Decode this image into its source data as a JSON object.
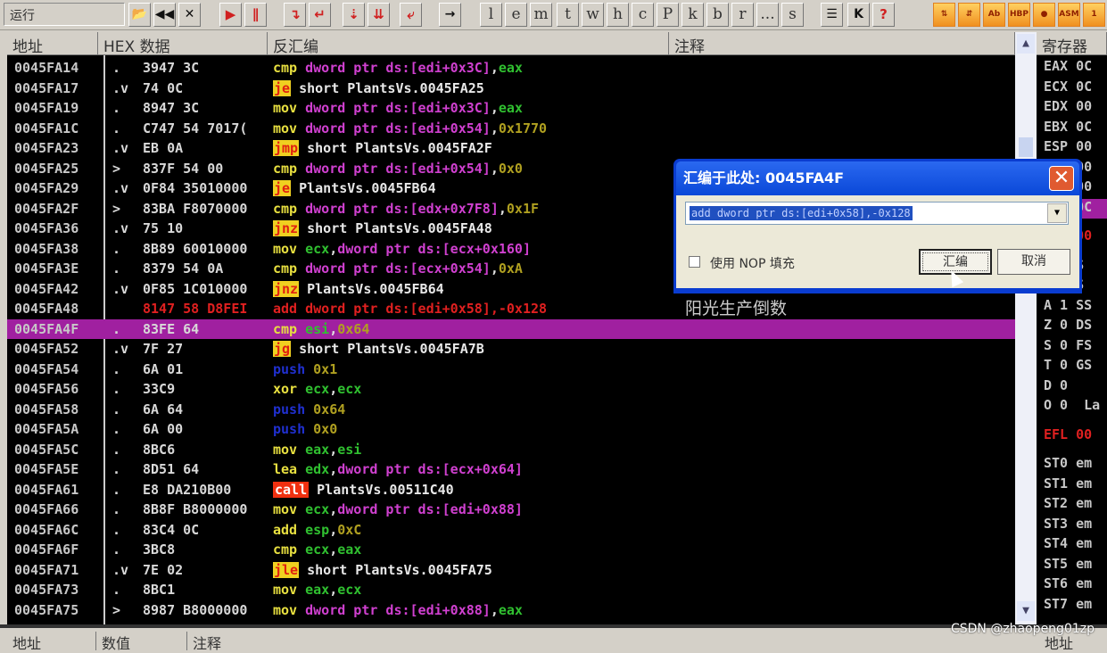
{
  "toolbar": {
    "status": "运行",
    "buttons": [
      {
        "icon": "open-folder-icon",
        "label": "📂",
        "cls": "dark"
      },
      {
        "icon": "restart-icon",
        "label": "◀◀",
        "cls": "dark"
      },
      {
        "icon": "close-icon",
        "label": "✕",
        "cls": "dark"
      },
      {
        "icon": "run-icon",
        "label": "▶",
        "cls": "red"
      },
      {
        "icon": "pause-icon",
        "label": "∥",
        "cls": "red"
      },
      {
        "icon": "step-into-icon",
        "label": "↴",
        "cls": "red"
      },
      {
        "icon": "step-over-icon",
        "label": "↵",
        "cls": "red"
      },
      {
        "icon": "trace-into-icon",
        "label": "⇣",
        "cls": "red"
      },
      {
        "icon": "trace-over-icon",
        "label": "⇊",
        "cls": "red"
      },
      {
        "icon": "execute-till-return-icon",
        "label": "⤶",
        "cls": "red"
      },
      {
        "icon": "go-to-icon",
        "label": "→",
        "cls": "dark"
      },
      {
        "icon": "log-window",
        "label": "l"
      },
      {
        "icon": "modules-window",
        "label": "e"
      },
      {
        "icon": "memory-window",
        "label": "m"
      },
      {
        "icon": "threads-window",
        "label": "t"
      },
      {
        "icon": "windows-window",
        "label": "w"
      },
      {
        "icon": "handles-window",
        "label": "h"
      },
      {
        "icon": "cpu-window",
        "label": "c"
      },
      {
        "icon": "patches-window",
        "label": "P"
      },
      {
        "icon": "call-stack-window",
        "label": "k"
      },
      {
        "icon": "breakpoints-window",
        "label": "b"
      },
      {
        "icon": "references-window",
        "label": "r"
      },
      {
        "icon": "run-trace-window",
        "label": "..."
      },
      {
        "icon": "source-window",
        "label": "s"
      },
      {
        "icon": "list-icon",
        "label": "☰",
        "cls": "dark"
      },
      {
        "icon": "plugin-icon",
        "label": "K",
        "cls": "dark"
      },
      {
        "icon": "help-icon",
        "label": "?",
        "cls": "red"
      },
      {
        "icon": "plugin-1-icon",
        "label": "⇅",
        "cls": "orange"
      },
      {
        "icon": "plugin-2-icon",
        "label": "⇵",
        "cls": "orange"
      },
      {
        "icon": "plugin-3-icon",
        "label": "Ab",
        "cls": "orange"
      },
      {
        "icon": "hbp-icon",
        "label": "HBP",
        "cls": "orange"
      },
      {
        "icon": "plugin-5-icon",
        "label": "●",
        "cls": "orange"
      },
      {
        "icon": "asm-icon",
        "label": "ASM",
        "cls": "orange"
      },
      {
        "icon": "plugin-7-icon",
        "label": "1",
        "cls": "orange"
      }
    ]
  },
  "headers": {
    "address": "地址",
    "hex": "HEX 数据",
    "disasm": "反汇编",
    "comment": "注释",
    "registers": "寄存器"
  },
  "bottom_headers": {
    "address": "地址",
    "value": "数值",
    "comment": "注释",
    "stack": "地址"
  },
  "colors": {
    "selection": "#a020a0",
    "background": "#000000",
    "jump_bg": "#f0d020",
    "call_bg": "#f03010",
    "memory": "#d040d0",
    "register": "#30c030",
    "immediate": "#b0a020",
    "push": "#2030d0",
    "modified": "#e02020"
  },
  "rows": [
    {
      "addr": "0045FA14",
      "mk": ".",
      "hex": "3947 3C",
      "dis": [
        [
          "cmp",
          "mn"
        ],
        [
          " "
        ],
        [
          "dword ptr ds:[edi+0x3C]",
          "mem"
        ],
        [
          ","
        ],
        [
          "eax",
          "reg"
        ]
      ]
    },
    {
      "addr": "0045FA17",
      "mk": ".v",
      "hex": "74 0C",
      "dis": [
        [
          "je",
          "jmp"
        ],
        [
          " "
        ],
        [
          "short PlantsVs.0045FA25",
          "lbl"
        ]
      ]
    },
    {
      "addr": "0045FA19",
      "mk": ".",
      "hex": "8947 3C",
      "dis": [
        [
          "mov",
          "mn"
        ],
        [
          " "
        ],
        [
          "dword ptr ds:[edi+0x3C]",
          "mem"
        ],
        [
          ","
        ],
        [
          "eax",
          "reg"
        ]
      ]
    },
    {
      "addr": "0045FA1C",
      "mk": ".",
      "hex": "C747 54 7017(",
      "dis": [
        [
          "mov",
          "mn"
        ],
        [
          " "
        ],
        [
          "dword ptr ds:[edi+0x54]",
          "mem"
        ],
        [
          ","
        ],
        [
          "0x1770",
          "imm"
        ]
      ]
    },
    {
      "addr": "0045FA23",
      "mk": ".v",
      "hex": "EB 0A",
      "dis": [
        [
          "jmp",
          "jmp"
        ],
        [
          " "
        ],
        [
          "short PlantsVs.0045FA2F",
          "lbl"
        ]
      ]
    },
    {
      "addr": "0045FA25",
      "mk": ">",
      "hex": "837F 54 00",
      "dis": [
        [
          "cmp",
          "mn"
        ],
        [
          " "
        ],
        [
          "dword ptr ds:[edi+0x54]",
          "mem"
        ],
        [
          ","
        ],
        [
          "0x0",
          "imm"
        ]
      ]
    },
    {
      "addr": "0045FA29",
      "mk": ".v",
      "hex": "0F84 35010000",
      "dis": [
        [
          "je",
          "jmp"
        ],
        [
          " "
        ],
        [
          "PlantsVs.0045FB64",
          "lbl"
        ]
      ]
    },
    {
      "addr": "0045FA2F",
      "mk": ">",
      "hex": "83BA F8070000",
      "dis": [
        [
          "cmp",
          "mn"
        ],
        [
          " "
        ],
        [
          "dword ptr ds:[edx+0x7F8]",
          "mem"
        ],
        [
          ","
        ],
        [
          "0x1F",
          "imm"
        ]
      ]
    },
    {
      "addr": "0045FA36",
      "mk": ".v",
      "hex": "75 10",
      "dis": [
        [
          "jnz",
          "jmp"
        ],
        [
          " "
        ],
        [
          "short PlantsVs.0045FA48",
          "lbl"
        ]
      ]
    },
    {
      "addr": "0045FA38",
      "mk": ".",
      "hex": "8B89 60010000",
      "dis": [
        [
          "mov",
          "mn"
        ],
        [
          " "
        ],
        [
          "ecx",
          "reg"
        ],
        [
          ","
        ],
        [
          "dword ptr ds:[ecx+0x160]",
          "mem"
        ]
      ]
    },
    {
      "addr": "0045FA3E",
      "mk": ".",
      "hex": "8379 54 0A",
      "dis": [
        [
          "cmp",
          "mn"
        ],
        [
          " "
        ],
        [
          "dword ptr ds:[ecx+0x54]",
          "mem"
        ],
        [
          ","
        ],
        [
          "0xA",
          "imm"
        ]
      ]
    },
    {
      "addr": "0045FA42",
      "mk": ".v",
      "hex": "0F85 1C010000",
      "dis": [
        [
          "jnz",
          "jmp"
        ],
        [
          " "
        ],
        [
          "PlantsVs.0045FB64",
          "lbl"
        ]
      ]
    },
    {
      "addr": "0045FA48",
      "mk": "",
      "hex": "8147 58 D8FEI",
      "mod": true,
      "dis": [
        [
          "add dword ptr ds:[edi+0x58],-0x128",
          "mod"
        ]
      ]
    },
    {
      "addr": "0045FA4F",
      "mk": ".",
      "hex": "83FE 64",
      "sel": true,
      "dis": [
        [
          "cmp",
          "mn"
        ],
        [
          " "
        ],
        [
          "esi",
          "reg"
        ],
        [
          ","
        ],
        [
          "0x64",
          "imm"
        ]
      ],
      "comment": ""
    },
    {
      "addr": "0045FA52",
      "mk": ".v",
      "hex": "7F 27",
      "dis": [
        [
          "jg",
          "jmp"
        ],
        [
          " "
        ],
        [
          "short PlantsVs.0045FA7B",
          "lbl"
        ]
      ]
    },
    {
      "addr": "0045FA54",
      "mk": ".",
      "hex": "6A 01",
      "dis": [
        [
          "push",
          "push"
        ],
        [
          " "
        ],
        [
          "0x1",
          "imm"
        ]
      ]
    },
    {
      "addr": "0045FA56",
      "mk": ".",
      "hex": "33C9",
      "dis": [
        [
          "xor",
          "mn"
        ],
        [
          " "
        ],
        [
          "ecx",
          "reg"
        ],
        [
          ","
        ],
        [
          "ecx",
          "reg"
        ]
      ]
    },
    {
      "addr": "0045FA58",
      "mk": ".",
      "hex": "6A 64",
      "dis": [
        [
          "push",
          "push"
        ],
        [
          " "
        ],
        [
          "0x64",
          "imm"
        ]
      ]
    },
    {
      "addr": "0045FA5A",
      "mk": ".",
      "hex": "6A 00",
      "dis": [
        [
          "push",
          "push"
        ],
        [
          " "
        ],
        [
          "0x0",
          "imm"
        ]
      ]
    },
    {
      "addr": "0045FA5C",
      "mk": ".",
      "hex": "8BC6",
      "dis": [
        [
          "mov",
          "mn"
        ],
        [
          " "
        ],
        [
          "eax",
          "reg"
        ],
        [
          ","
        ],
        [
          "esi",
          "reg"
        ]
      ]
    },
    {
      "addr": "0045FA5E",
      "mk": ".",
      "hex": "8D51 64",
      "dis": [
        [
          "lea",
          "mn"
        ],
        [
          " "
        ],
        [
          "edx",
          "reg"
        ],
        [
          ","
        ],
        [
          "dword ptr ds:[ecx+0x64]",
          "mem"
        ]
      ]
    },
    {
      "addr": "0045FA61",
      "mk": ".",
      "hex": "E8 DA210B00",
      "dis": [
        [
          "call",
          "call"
        ],
        [
          " "
        ],
        [
          "PlantsVs.00511C40",
          "lbl"
        ]
      ]
    },
    {
      "addr": "0045FA66",
      "mk": ".",
      "hex": "8B8F B8000000",
      "dis": [
        [
          "mov",
          "mn"
        ],
        [
          " "
        ],
        [
          "ecx",
          "reg"
        ],
        [
          ","
        ],
        [
          "dword ptr ds:[edi+0x88]",
          "mem"
        ]
      ]
    },
    {
      "addr": "0045FA6C",
      "mk": ".",
      "hex": "83C4 0C",
      "dis": [
        [
          "add",
          "mn"
        ],
        [
          " "
        ],
        [
          "esp",
          "reg"
        ],
        [
          ","
        ],
        [
          "0xC",
          "imm"
        ]
      ]
    },
    {
      "addr": "0045FA6F",
      "mk": ".",
      "hex": "3BC8",
      "dis": [
        [
          "cmp",
          "mn"
        ],
        [
          " "
        ],
        [
          "ecx",
          "reg"
        ],
        [
          ","
        ],
        [
          "eax",
          "reg"
        ]
      ]
    },
    {
      "addr": "0045FA71",
      "mk": ".v",
      "hex": "7E 02",
      "dis": [
        [
          "jle",
          "jmp"
        ],
        [
          " "
        ],
        [
          "short PlantsVs.0045FA75",
          "lbl"
        ]
      ]
    },
    {
      "addr": "0045FA73",
      "mk": ".",
      "hex": "8BC1",
      "dis": [
        [
          "mov",
          "mn"
        ],
        [
          " "
        ],
        [
          "eax",
          "reg"
        ],
        [
          ","
        ],
        [
          "ecx",
          "reg"
        ]
      ]
    },
    {
      "addr": "0045FA75",
      "mk": ">",
      "hex": "8987 B8000000",
      "dis": [
        [
          "mov",
          "mn"
        ],
        [
          " "
        ],
        [
          "dword ptr ds:[edi+0x88]",
          "mem"
        ],
        [
          ","
        ],
        [
          "eax",
          "reg"
        ]
      ]
    }
  ],
  "comment_row": {
    "text": "阳光生产倒数"
  },
  "registers": [
    {
      "t": "EAX 0C"
    },
    {
      "t": "ECX 0C"
    },
    {
      "t": "EDX 00"
    },
    {
      "t": "EBX 0C"
    },
    {
      "t": "ESP 00"
    },
    {
      "t": "    00"
    },
    {
      "t": "    00"
    },
    {
      "t": "    0C",
      "hl": true
    },
    {
      "t": "    00",
      "red": true,
      "gap": 1
    },
    {
      "t": "   ES",
      "gap": 1
    },
    {
      "t": "   CS"
    },
    {
      "t": "A 1 SS"
    },
    {
      "t": "Z 0 DS"
    },
    {
      "t": "S 0 FS",
      "sflag": true
    },
    {
      "t": "T 0 GS"
    },
    {
      "t": "D 0"
    },
    {
      "t": "O 0  La"
    },
    {
      "t": "EFL 00",
      "red": true,
      "gap": 1
    },
    {
      "t": "ST0 em",
      "gap": 1
    },
    {
      "t": "ST1 em"
    },
    {
      "t": "ST2 em"
    },
    {
      "t": "ST3 em"
    },
    {
      "t": "ST4 em"
    },
    {
      "t": "ST5 em"
    },
    {
      "t": "ST6 em"
    },
    {
      "t": "ST7 em"
    }
  ],
  "dialog": {
    "title": "汇编于此处: 0045FA4F",
    "input_value": "add dword ptr ds:[edi+0x58],-0x128",
    "checkbox_label": "使用 NOP 填充",
    "checkbox_checked": false,
    "assemble_button": "汇编",
    "cancel_button": "取消"
  },
  "watermark": "CSDN @zhaopeng01zp"
}
